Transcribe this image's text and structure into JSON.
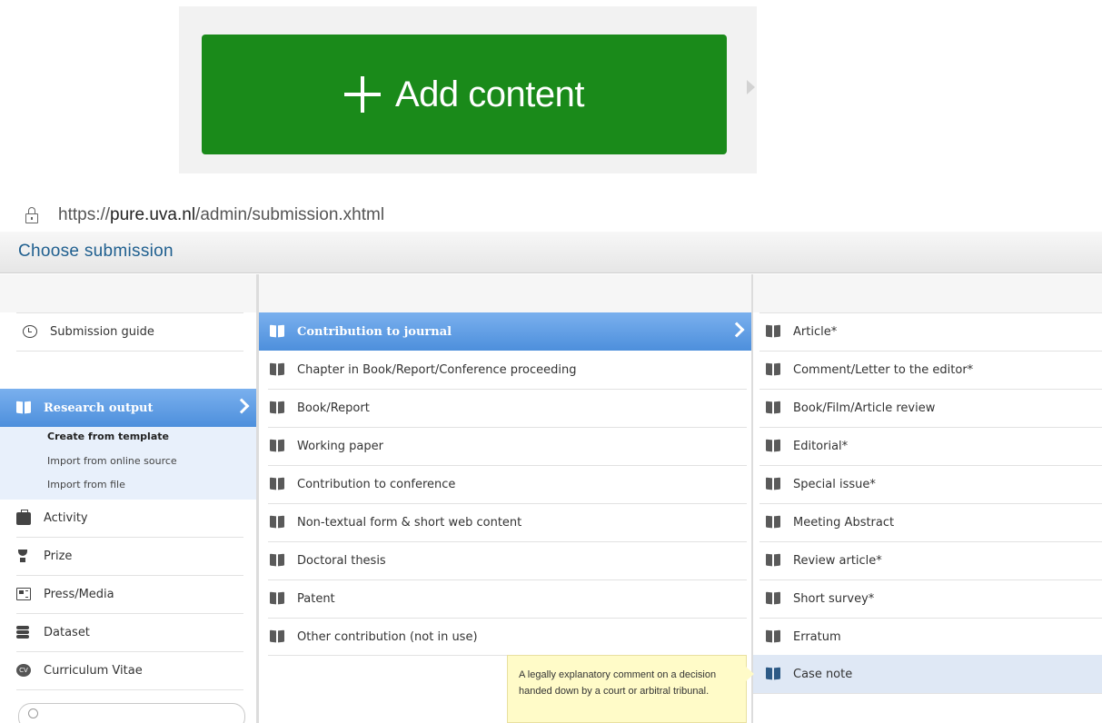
{
  "add_content": {
    "label": "Add content"
  },
  "address_bar": {
    "scheme": "https://",
    "host": "pure.uva.nl",
    "path": "/admin/submission.xhtml"
  },
  "window": {
    "title": "Choose submission"
  },
  "left_menu": {
    "guide": "Submission guide",
    "research_output": "Research output",
    "sub_items": [
      "Create from template",
      "Import from online source",
      "Import from file"
    ],
    "items": [
      "Activity",
      "Prize",
      "Press/Media",
      "Dataset",
      "Curriculum Vitae"
    ]
  },
  "middle_menu": {
    "items": [
      "Contribution to journal",
      "Chapter in Book/Report/Conference proceeding",
      "Book/Report",
      "Working paper",
      "Contribution to conference",
      "Non-textual form & short web content",
      "Doctoral thesis",
      "Patent",
      "Other contribution (not in use)"
    ]
  },
  "right_menu": {
    "items": [
      "Article*",
      "Comment/Letter to the editor*",
      "Book/Film/Article review",
      "Editorial*",
      "Special issue*",
      "Meeting Abstract",
      "Review article*",
      "Short survey*",
      "Erratum",
      "Case note"
    ]
  },
  "tooltip": {
    "text": "A legally explanatory comment on a decision handed down by a court or arbitral tribunal."
  },
  "icons": {
    "plus": "plus-icon",
    "lock": "lock-icon",
    "history": "history-icon",
    "book": "book-icon",
    "chevron": "chevron-right-icon",
    "briefcase": "briefcase-icon",
    "trophy": "trophy-icon",
    "press": "newspaper-icon",
    "dataset": "database-icon",
    "cv": "cv-icon",
    "search": "search-icon"
  },
  "colors": {
    "add_button": "#1a8a1a",
    "selected": "#4d8fdc",
    "title": "#1f5f8f",
    "tooltip": "#fffbc8"
  }
}
